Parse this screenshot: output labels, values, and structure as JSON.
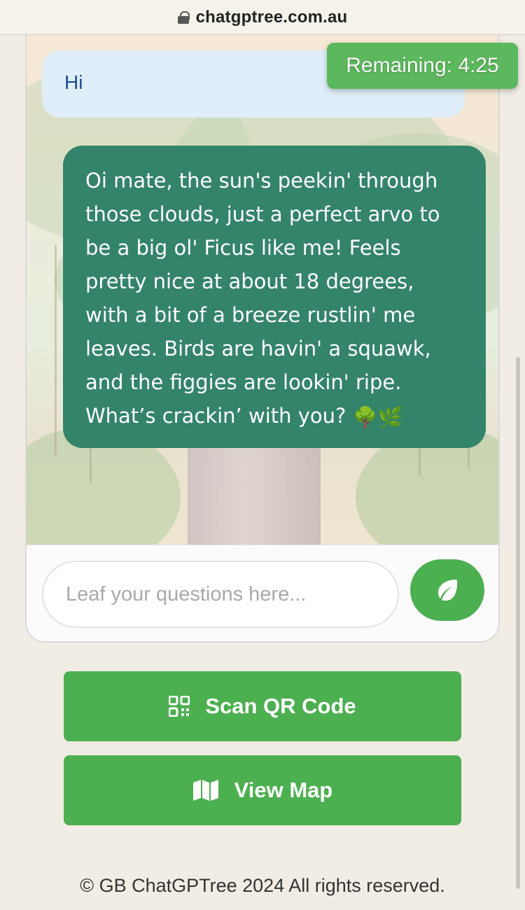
{
  "browser": {
    "url": "chatgptree.com.au"
  },
  "timer": {
    "text": "Remaining: 4:25"
  },
  "chat": {
    "messages": [
      {
        "role": "user",
        "text": "Hi"
      },
      {
        "role": "assistant",
        "text": "Oi mate, the sun's peekin' through those clouds, just a perfect arvo to be a big ol' Ficus like me! Feels pretty nice at about 18 degrees, with a bit of a breeze rustlin' me leaves. Birds are havin' a squawk, and the figgies are lookin' ripe. What’s crackin’ with you?",
        "emoji": "🌳🌿"
      }
    ],
    "input_placeholder": "Leaf your questions here...",
    "input_value": ""
  },
  "actions": {
    "scan_qr": {
      "label": "Scan QR Code",
      "icon": "qr-code-icon"
    },
    "view_map": {
      "label": "View Map",
      "icon": "map-icon"
    }
  },
  "footer": {
    "text": "© GB ChatGPTree 2024 All rights reserved."
  },
  "colors": {
    "primary_green": "#4caf50",
    "bot_bubble": "#34836b",
    "user_bubble": "#dfeef8",
    "user_text": "#1f4c8c",
    "page_bg": "#f1ede4"
  }
}
